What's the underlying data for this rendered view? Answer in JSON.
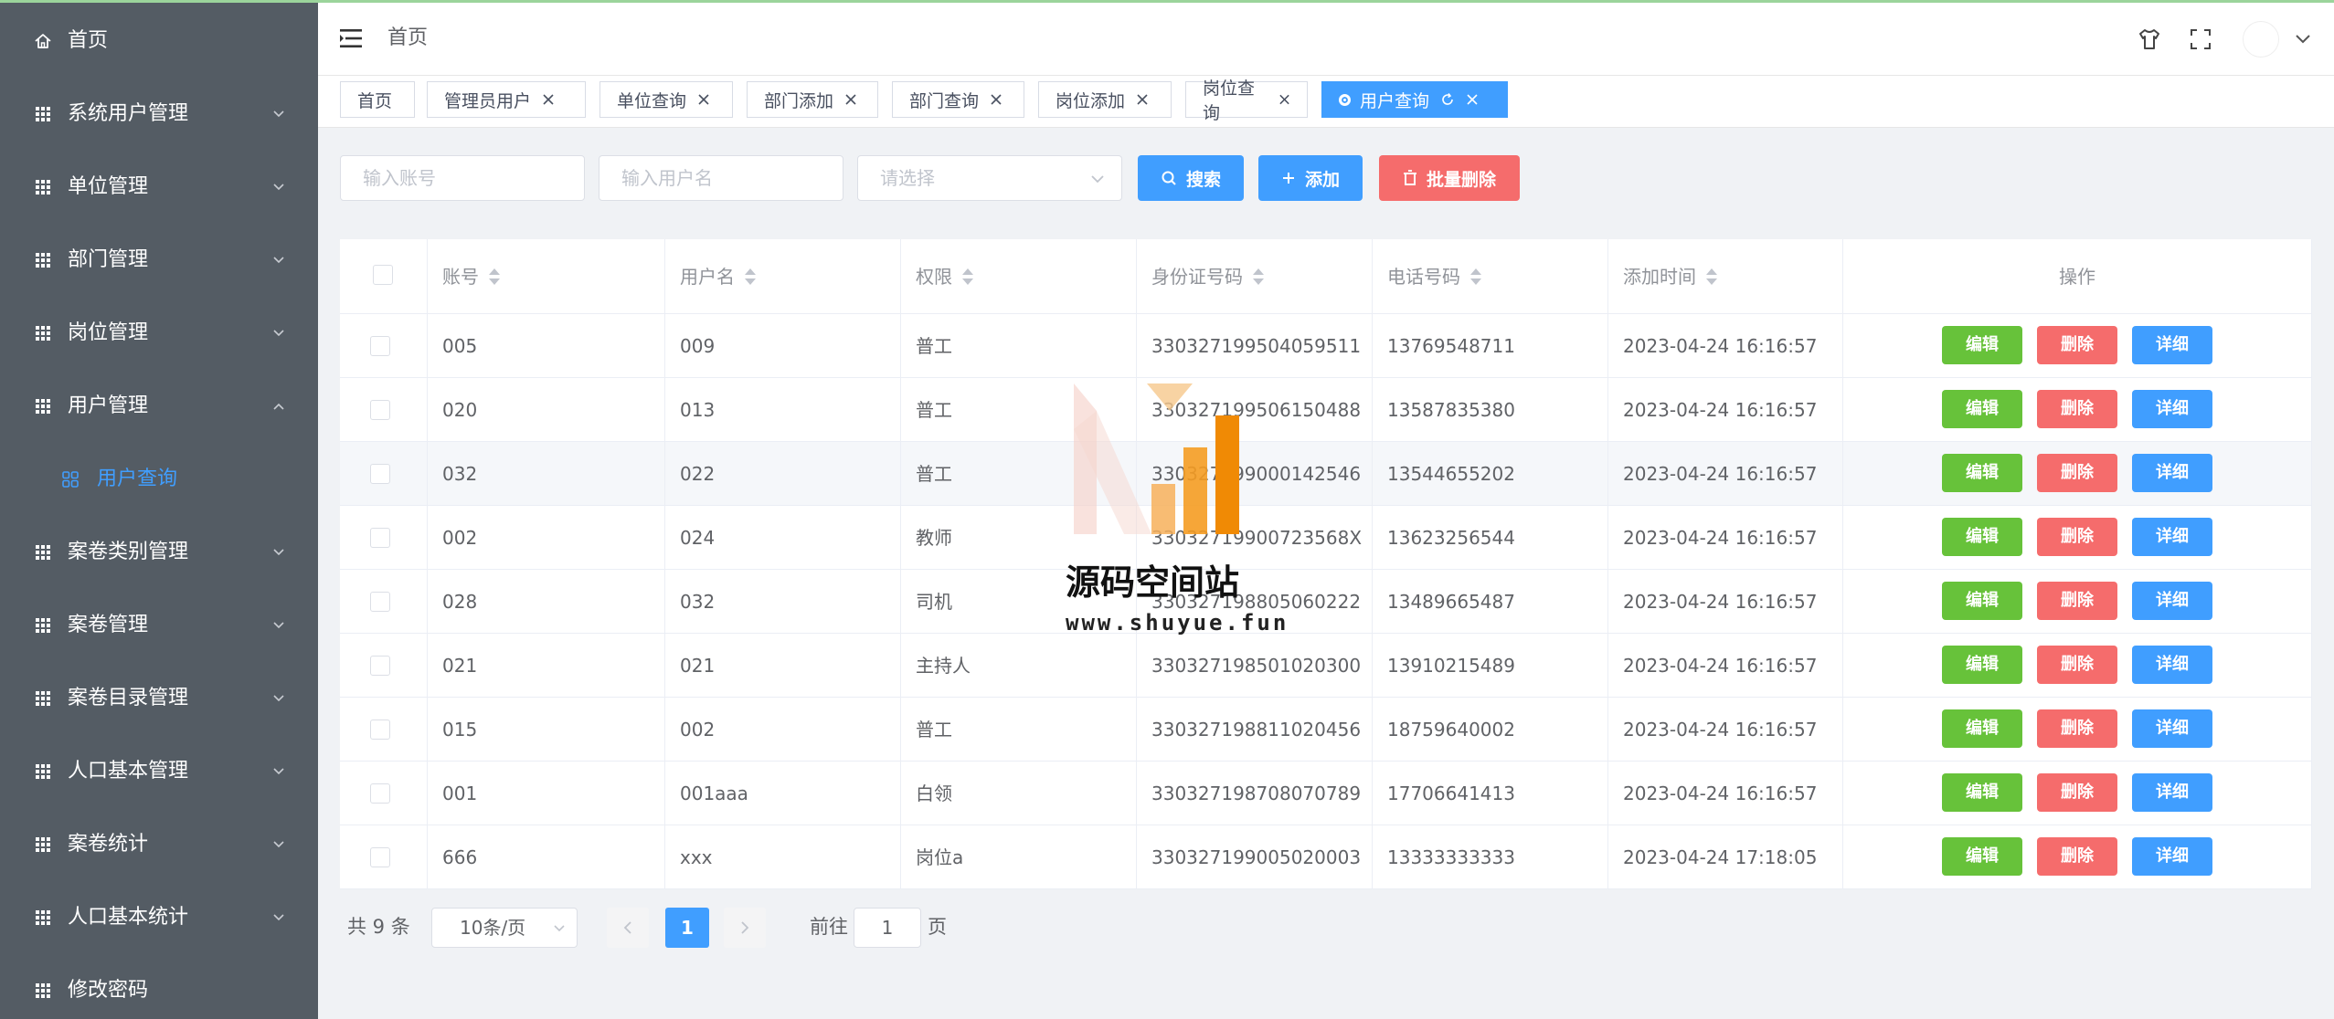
{
  "sidebar": {
    "items": [
      {
        "label": "首页",
        "icon": "home-icon"
      },
      {
        "label": "系统用户管理",
        "icon": "grid-icon"
      },
      {
        "label": "单位管理",
        "icon": "grid-icon"
      },
      {
        "label": "部门管理",
        "icon": "grid-icon"
      },
      {
        "label": "岗位管理",
        "icon": "grid-icon"
      },
      {
        "label": "用户管理",
        "icon": "grid-icon",
        "expanded": true
      },
      {
        "label": "用户查询",
        "icon": "apps-icon",
        "active": true
      },
      {
        "label": "案卷类别管理",
        "icon": "grid-icon"
      },
      {
        "label": "案卷管理",
        "icon": "grid-icon"
      },
      {
        "label": "案卷目录管理",
        "icon": "grid-icon"
      },
      {
        "label": "人口基本管理",
        "icon": "grid-icon"
      },
      {
        "label": "案卷统计",
        "icon": "grid-icon"
      },
      {
        "label": "人口基本统计",
        "icon": "grid-icon"
      },
      {
        "label": "修改密码",
        "icon": "grid-icon"
      }
    ]
  },
  "header": {
    "breadcrumb": "首页"
  },
  "tags": [
    {
      "label": "首页"
    },
    {
      "label": "管理员用户"
    },
    {
      "label": "单位查询"
    },
    {
      "label": "部门添加"
    },
    {
      "label": "部门查询"
    },
    {
      "label": "岗位添加"
    },
    {
      "label": "岗位查询"
    },
    {
      "label": "用户查询",
      "active": true
    }
  ],
  "search": {
    "account_placeholder": "输入账号",
    "username_placeholder": "输入用户名",
    "select_placeholder": "请选择",
    "search_label": "搜索",
    "add_label": "添加",
    "batch_delete_label": "批量删除"
  },
  "table": {
    "columns": [
      "账号",
      "用户名",
      "权限",
      "身份证号码",
      "电话号码",
      "添加时间",
      "操作"
    ],
    "actions": {
      "edit": "编辑",
      "delete": "删除",
      "detail": "详细"
    },
    "rows": [
      [
        "005",
        "009",
        "普工",
        "330327199504059511",
        "13769548711",
        "2023-04-24 16:16:57"
      ],
      [
        "020",
        "013",
        "普工",
        "330327199506150488",
        "13587835380",
        "2023-04-24 16:16:57"
      ],
      [
        "032",
        "022",
        "普工",
        "330327199000142546",
        "13544655202",
        "2023-04-24 16:16:57"
      ],
      [
        "002",
        "024",
        "教师",
        "33032719900723568X",
        "13623256544",
        "2023-04-24 16:16:57"
      ],
      [
        "028",
        "032",
        "司机",
        "330327198805060222",
        "13489665487",
        "2023-04-24 16:16:57"
      ],
      [
        "021",
        "021",
        "主持人",
        "330327198501020300",
        "13910215489",
        "2023-04-24 16:16:57"
      ],
      [
        "015",
        "002",
        "普工",
        "330327198811020456",
        "18759640002",
        "2023-04-24 16:16:57"
      ],
      [
        "001",
        "001aaa",
        "白领",
        "330327198708070789",
        "17706641413",
        "2023-04-24 16:16:57"
      ],
      [
        "666",
        "xxx",
        "岗位a",
        "330327199005020003",
        "13333333333",
        "2023-04-24 17:18:05"
      ]
    ]
  },
  "pagination": {
    "total_text": "共 9 条",
    "page_size": "10条/页",
    "current_page": "1",
    "goto_label": "前往",
    "goto_value": "1",
    "page_unit": "页"
  },
  "watermark": {
    "text": "源码空间站",
    "url": "www.shuyue.fun"
  },
  "colors": {
    "sidebar_bg": "#545c64",
    "primary": "#409eff",
    "success": "#67c23a",
    "danger": "#f56c6c",
    "batch_delete": "#f56c6c"
  }
}
